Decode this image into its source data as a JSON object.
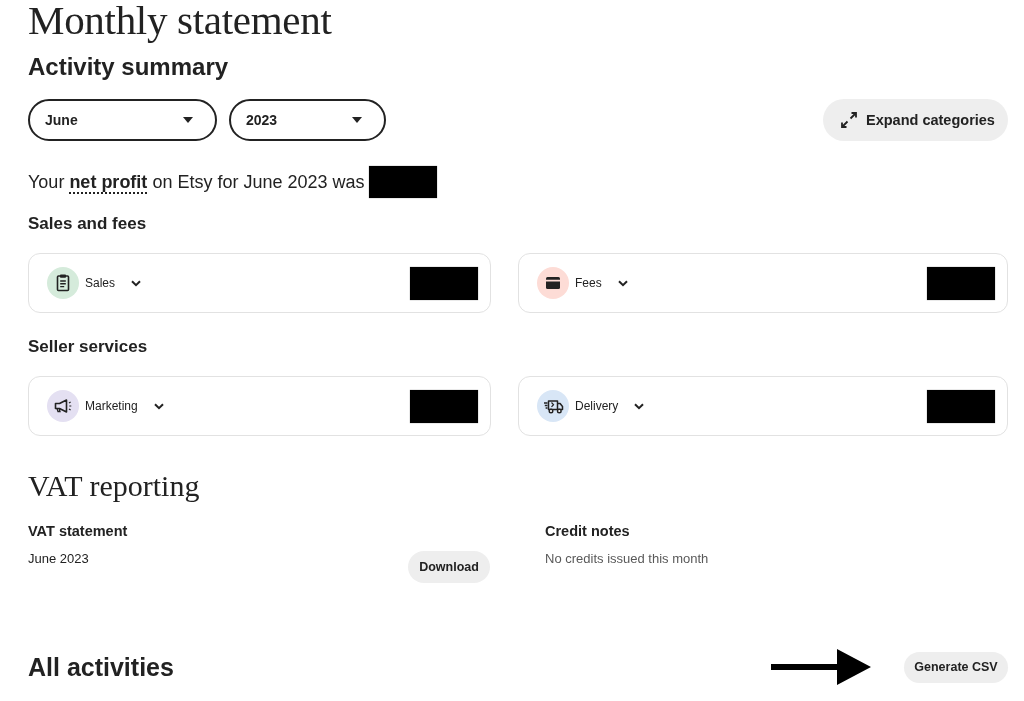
{
  "page": {
    "title": "Monthly statement"
  },
  "activity_summary": {
    "title": "Activity summary",
    "selects": [
      {
        "value": "June"
      },
      {
        "value": "2023"
      }
    ],
    "expand_button": "Expand categories",
    "net_profit": {
      "text": "Your **net profit** on Etsy for June 2023 was",
      "value_redacted": true
    }
  },
  "sections": [
    {
      "title": "Sales and fees",
      "categories": [
        {
          "label": "Sales",
          "kind": "sales",
          "color": "#d5ebdb",
          "value_redacted": true
        },
        {
          "label": "Fees",
          "kind": "fees",
          "color": "#fddcd6",
          "value_redacted": true
        }
      ]
    },
    {
      "title": "Seller services",
      "categories": [
        {
          "label": "Marketing",
          "kind": "marketing",
          "color": "#e4e0f2",
          "value_redacted": true
        },
        {
          "label": "Delivery",
          "kind": "delivery",
          "color": "#d8e6f6",
          "value_redacted": true
        }
      ]
    }
  ],
  "vat_reporting": {
    "title": "VAT reporting",
    "statement": {
      "heading": "VAT statement",
      "period": "June 2023",
      "button": "Download"
    },
    "credit_notes": {
      "heading": "Credit notes",
      "text": "No credits issued this month"
    }
  },
  "all_activities": {
    "title": "All activities",
    "button": "Generate CSV",
    "pointer_arrow": true
  }
}
